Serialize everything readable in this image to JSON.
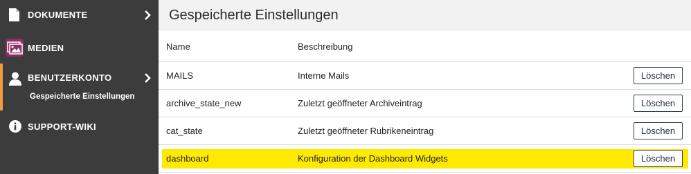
{
  "sidebar": {
    "items": [
      {
        "label": "DOKUMENTE",
        "icon": "document-icon"
      },
      {
        "label": "MEDIEN",
        "icon": "image-icon"
      },
      {
        "label": "BENUTZERKONTO",
        "icon": "user-icon",
        "sub": "Gespeicherte Einstellungen"
      },
      {
        "label": "SUPPORT-WIKI",
        "icon": "info-icon"
      }
    ]
  },
  "header": {
    "title": "Gespeicherte Einstellungen"
  },
  "table": {
    "columns": [
      "Name",
      "Beschreibung"
    ],
    "delete_label": "Löschen",
    "rows": [
      {
        "name": "MAILS",
        "description": "Interne Mails"
      },
      {
        "name": "archive_state_new",
        "description": "Zuletzt geöffneter Archiveintrag"
      },
      {
        "name": "cat_state",
        "description": "Zuletzt geöffneter Rubrikeneintrag"
      },
      {
        "name": "dashboard",
        "description": "Konfiguration der Dashboard Widgets"
      }
    ]
  },
  "colors": {
    "sidebar_bg": "#3c3c3c",
    "active_accent": "#f39c3d",
    "highlight": "#ffea00",
    "media_icon_bg": "#8e2e63"
  }
}
